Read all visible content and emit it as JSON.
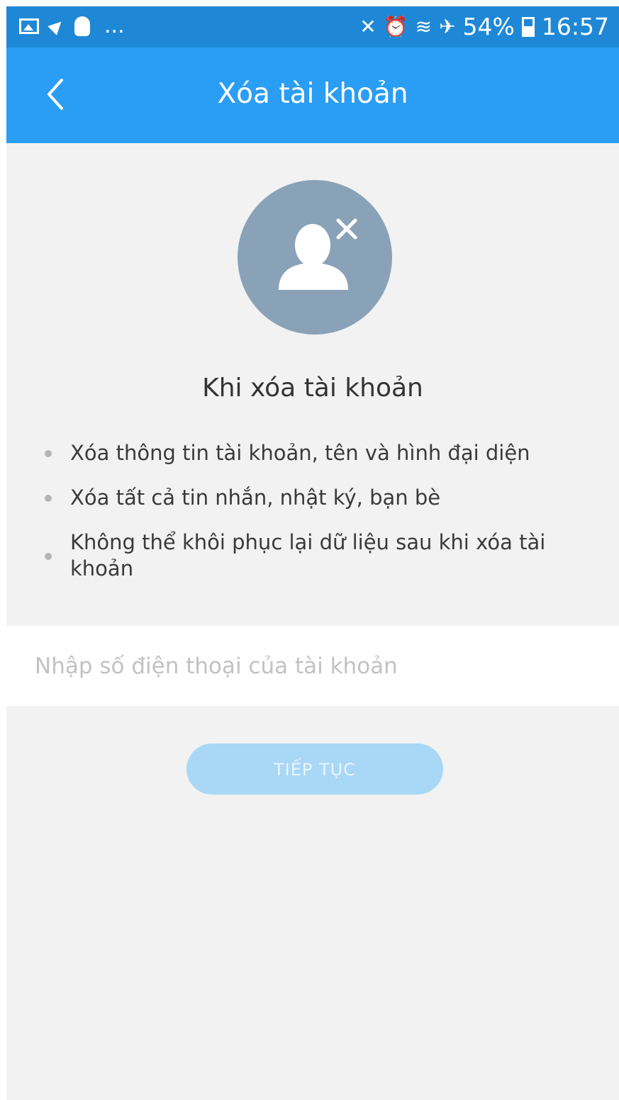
{
  "status_bar": {
    "left_icons": [
      "gallery-icon",
      "navigation-icon",
      "bulb-icon"
    ],
    "more": "...",
    "right_icons": [
      "mute-icon",
      "alarm-icon",
      "wifi-icon",
      "airplane-icon"
    ],
    "battery_text": "54%",
    "time": "16:57"
  },
  "app_bar": {
    "back_icon": "chevron-left-icon",
    "title": "Xóa tài khoản"
  },
  "info": {
    "avatar_icon": "user-remove-icon",
    "title": "Khi xóa tài khoản",
    "bullets": [
      "Xóa thông tin tài khoản, tên và hình đại diện",
      "Xóa tất cả tin nhắn, nhật ký, bạn bè",
      "Không thể khôi phục lại dữ liệu sau khi xóa tài khoản"
    ]
  },
  "phone_input": {
    "value": "",
    "placeholder": "Nhập số điện thoại của tài khoản"
  },
  "continue_button": {
    "label": "TIẾP TỤC"
  },
  "colors": {
    "status_bar": "#1f88d6",
    "app_bar": "#2a9df4",
    "background": "#f2f2f2",
    "avatar_circle": "#8aa2b8",
    "button_disabled": "#a9d7f6"
  }
}
